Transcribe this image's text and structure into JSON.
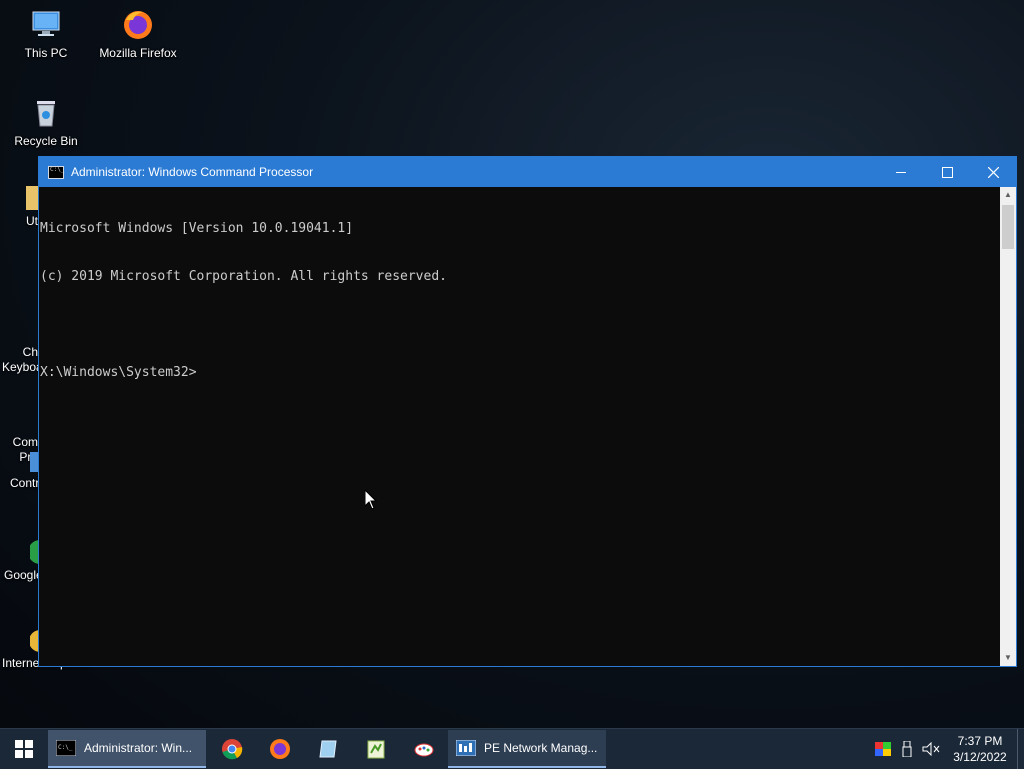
{
  "desktop": {
    "icons": [
      {
        "label": "This PC"
      },
      {
        "label": "Mozilla Firefox"
      },
      {
        "label": "Recycle Bin"
      }
    ],
    "partial_icons": [
      {
        "label": "Uti"
      },
      {
        "label": "Ch\nKeyboa"
      },
      {
        "label": "Com\nPro"
      },
      {
        "label": "Contr"
      },
      {
        "label": "Google"
      },
      {
        "label": "Internet Explorer"
      }
    ]
  },
  "window": {
    "title": "Administrator: Windows Command Processor",
    "lines": [
      "Microsoft Windows [Version 10.0.19041.1]",
      "(c) 2019 Microsoft Corporation. All rights reserved.",
      "",
      "X:\\Windows\\System32>"
    ]
  },
  "taskbar": {
    "active_task": "Administrator: Win...",
    "network_task": "PE Network Manag...",
    "pinned": [
      "chrome-icon",
      "firefox-icon",
      "notepad-icon",
      "notepad-plus-icon",
      "paint-icon"
    ],
    "clock_time": "7:37 PM",
    "clock_date": "3/12/2022"
  },
  "colors": {
    "titlebar": "#2b7bd4",
    "console_bg": "#0c0c0c",
    "console_text": "#cccccc",
    "taskbar": "#1b2838"
  }
}
